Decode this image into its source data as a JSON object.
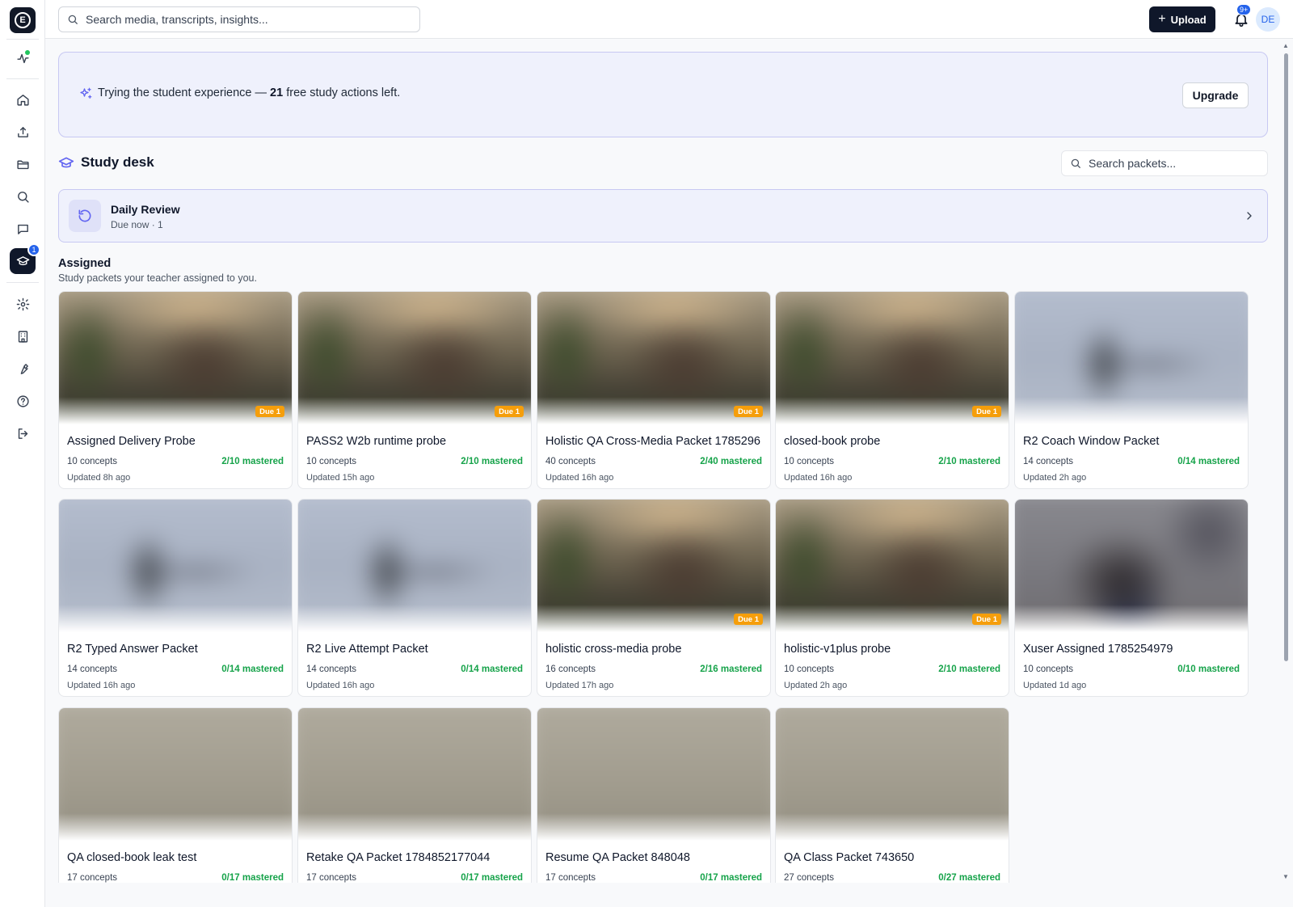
{
  "topbar": {
    "search_placeholder": "Search media, transcripts, insights...",
    "upload_label": "Upload",
    "notifications_badge": "9+",
    "avatar_initials": "DE"
  },
  "sidebar": {
    "study_badge": "1"
  },
  "banner": {
    "text_before": "Trying the student experience — ",
    "count": "21",
    "text_after": " free study actions left.",
    "upgrade_label": "Upgrade"
  },
  "study_desk": {
    "title": "Study desk",
    "search_placeholder": "Search packets..."
  },
  "daily_review": {
    "title": "Daily Review",
    "subtitle": "Due now · 1"
  },
  "assigned": {
    "title": "Assigned",
    "subtitle": "Study packets your teacher assigned to you."
  },
  "packets": [
    {
      "title": "Assigned Delivery Probe",
      "concepts": "10 concepts",
      "mastered": "2/10 mastered",
      "updated": "Updated 8h ago",
      "due": "Due 1",
      "thumb": "a"
    },
    {
      "title": "PASS2 W2b runtime probe",
      "concepts": "10 concepts",
      "mastered": "2/10 mastered",
      "updated": "Updated 15h ago",
      "due": "Due 1",
      "thumb": "a"
    },
    {
      "title": "Holistic QA Cross-Media Packet 1785296",
      "concepts": "40 concepts",
      "mastered": "2/40 mastered",
      "updated": "Updated 16h ago",
      "due": "Due 1",
      "thumb": "a"
    },
    {
      "title": "closed-book probe",
      "concepts": "10 concepts",
      "mastered": "2/10 mastered",
      "updated": "Updated 16h ago",
      "due": "Due 1",
      "thumb": "a"
    },
    {
      "title": "R2 Coach Window Packet",
      "concepts": "14 concepts",
      "mastered": "0/14 mastered",
      "updated": "Updated 2h ago",
      "due": "",
      "thumb": "b"
    },
    {
      "title": "R2 Typed Answer Packet",
      "concepts": "14 concepts",
      "mastered": "0/14 mastered",
      "updated": "Updated 16h ago",
      "due": "",
      "thumb": "b"
    },
    {
      "title": "R2 Live Attempt Packet",
      "concepts": "14 concepts",
      "mastered": "0/14 mastered",
      "updated": "Updated 16h ago",
      "due": "",
      "thumb": "b"
    },
    {
      "title": "holistic cross-media probe",
      "concepts": "16 concepts",
      "mastered": "2/16 mastered",
      "updated": "Updated 17h ago",
      "due": "Due 1",
      "thumb": "a"
    },
    {
      "title": "holistic-v1plus probe",
      "concepts": "10 concepts",
      "mastered": "2/10 mastered",
      "updated": "Updated 2h ago",
      "due": "Due 1",
      "thumb": "a"
    },
    {
      "title": "Xuser Assigned 1785254979",
      "concepts": "10 concepts",
      "mastered": "0/10 mastered",
      "updated": "Updated 1d ago",
      "due": "",
      "thumb": "c"
    },
    {
      "title": "QA closed-book leak test",
      "concepts": "17 concepts",
      "mastered": "0/17 mastered",
      "updated": "",
      "due": "",
      "thumb": "d"
    },
    {
      "title": "Retake QA Packet 1784852177044",
      "concepts": "17 concepts",
      "mastered": "0/17 mastered",
      "updated": "",
      "due": "",
      "thumb": "d"
    },
    {
      "title": "Resume QA Packet 848048",
      "concepts": "17 concepts",
      "mastered": "0/17 mastered",
      "updated": "",
      "due": "",
      "thumb": "d"
    },
    {
      "title": "QA Class Packet 743650",
      "concepts": "27 concepts",
      "mastered": "0/27 mastered",
      "updated": "",
      "due": "",
      "thumb": "d"
    }
  ]
}
